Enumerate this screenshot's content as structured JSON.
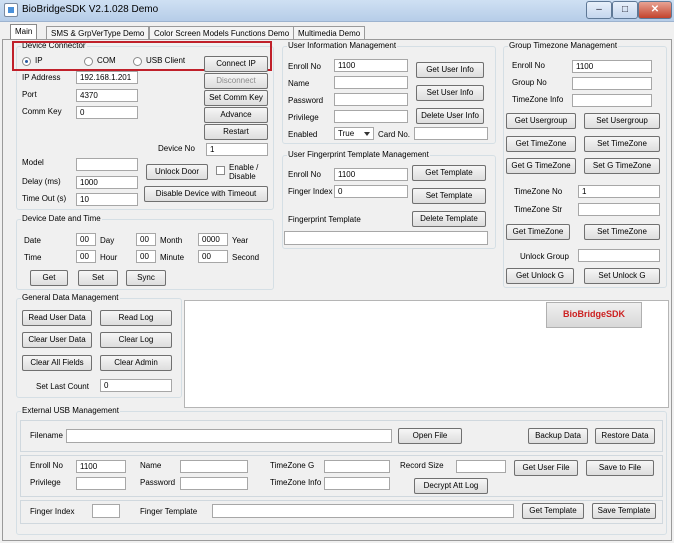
{
  "window": {
    "title": "BioBridgeSDK V2.1.028 Demo",
    "min": "–",
    "max": "□",
    "close": "✕"
  },
  "tabs": [
    "Main",
    "SMS & GrpVerType Demo",
    "Color Screen Models Functions Demo",
    "Multimedia Demo"
  ],
  "device_connector": {
    "legend": "Device Connector",
    "ip_label": "IP",
    "com_label": "COM",
    "usb_label": "USB Client",
    "connect_ip": "Connect IP",
    "ip_address_label": "IP Address",
    "ip_address": "192.168.1.201",
    "port_label": "Port",
    "port": "4370",
    "comm_key_label": "Comm Key",
    "comm_key": "0",
    "disconnect": "Disconnect",
    "set_comm_key": "Set Comm Key",
    "advance": "Advance",
    "restart": "Restart",
    "device_no_label": "Device No",
    "device_no": "1",
    "model_label": "Model",
    "model": "",
    "delay_label": "Delay (ms)",
    "delay": "1000",
    "timeout_label": "Time Out (s)",
    "timeout": "10",
    "unlock_door": "Unlock Door",
    "enable_disable": "Enable /",
    "enable_disable2": "Disable",
    "disable_timeout": "Disable Device with Timeout"
  },
  "date_time": {
    "legend": "Device Date and Time",
    "date_label": "Date",
    "day_value": "00",
    "day_label": "Day",
    "month_value": "00",
    "month_label": "Month",
    "year_value": "0000",
    "year_label": "Year",
    "time_label": "Time",
    "hour_value": "00",
    "hour_label": "Hour",
    "minute_value": "00",
    "minute_label": "Minute",
    "second_value": "00",
    "second_label": "Second",
    "get": "Get",
    "set": "Set",
    "sync": "Sync"
  },
  "user_info": {
    "legend": "User Information Management",
    "enroll_label": "Enroll No",
    "enroll": "1100",
    "name_label": "Name",
    "password_label": "Password",
    "privilege_label": "Privilege",
    "enabled_label": "Enabled",
    "enabled_value": "True",
    "card_label": "Card No.",
    "get_user_info": "Get User Info",
    "set_user_info": "Set User Info",
    "delete_user_info": "Delete User Info"
  },
  "fingerprint": {
    "legend": "User Fingerprint Template Management",
    "enroll_label": "Enroll No",
    "enroll": "1100",
    "finger_index_label": "Finger Index",
    "finger_index": "0",
    "template_label": "Fingerprint Template",
    "get_template": "Get Template",
    "set_template": "Set Template",
    "delete_template": "Delete Template"
  },
  "group_timezone": {
    "legend": "Group Timezone Management",
    "enroll_label": "Enroll No",
    "enroll": "1100",
    "group_label": "Group No",
    "timezone_info_label": "TimeZone Info",
    "get_usergroup": "Get Usergroup",
    "set_usergroup": "Set Usergroup",
    "get_timezone": "Get TimeZone",
    "set_timezone": "Set TimeZone",
    "get_g_timezone": "Get G TimeZone",
    "set_g_timezone": "Set G TimeZone",
    "timezone_no_label": "TimeZone No",
    "timezone_no": "1",
    "timezone_str_label": "TimeZone Str",
    "get_timezone2": "Get TimeZone",
    "set_timezone2": "Set TimeZone",
    "unlock_group_label": "Unlock Group",
    "get_unlock": "Get Unlock G",
    "set_unlock": "Set Unlock G"
  },
  "general": {
    "legend": "General Data Management",
    "read_user": "Read User Data",
    "read_log": "Read Log",
    "clear_user": "Clear User Data",
    "clear_log": "Clear Log",
    "clear_all": "Clear All Fields",
    "clear_admin": "Clear Admin",
    "set_last_count_label": "Set Last Count",
    "set_last_count": "0"
  },
  "logo": "BioBridgeSDK",
  "usb": {
    "legend": "External USB Management",
    "filename_label": "Filename",
    "open_file": "Open File",
    "backup_data": "Backup Data",
    "restore_data": "Restore Data",
    "enroll_label": "Enroll No",
    "enroll": "1100",
    "name_label": "Name",
    "timezone_g_label": "TimeZone G",
    "record_size_label": "Record Size",
    "get_user_file": "Get User File",
    "save_to_file": "Save to File",
    "privilege_label": "Privilege",
    "password_label": "Password",
    "timezone_info_label": "TimeZone Info",
    "decrypt": "Decrypt Att Log",
    "finger_index_label": "Finger Index",
    "finger_template_label": "Finger Template",
    "get_template": "Get Template",
    "save_template": "Save Template"
  }
}
